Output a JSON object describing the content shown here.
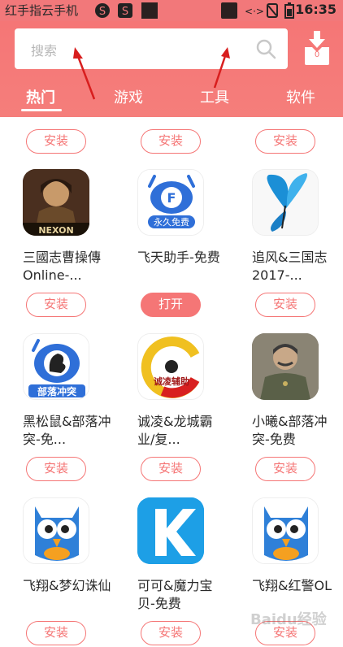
{
  "status": {
    "carrier_title": "红手指云手机",
    "time": "16:35"
  },
  "search": {
    "placeholder": "搜索",
    "download_badge": "0"
  },
  "tabs": [
    {
      "label": "热门"
    },
    {
      "label": "游戏"
    },
    {
      "label": "工具"
    },
    {
      "label": "软件"
    }
  ],
  "top_buttons": [
    "安装",
    "安装",
    "安装"
  ],
  "apps": [
    {
      "name": "三國志曹操傳Online-...",
      "button": "安装"
    },
    {
      "name": "飞天助手-免费",
      "button": "打开"
    },
    {
      "name": "追风&三国志2017-...",
      "button": "安装"
    },
    {
      "name": "黑松鼠&部落冲突-免...",
      "button": "安装"
    },
    {
      "name": "诚凌&龙城霸业/复...",
      "button": "安装"
    },
    {
      "name": "小曦&部落冲突-免费",
      "button": "安装"
    },
    {
      "name": "飞翔&梦幻诛仙",
      "button": "安装"
    },
    {
      "name": "可可&魔力宝贝-免费",
      "button": "安装"
    },
    {
      "name": "飞翔&红警OL",
      "button": "安装"
    }
  ],
  "icon_text": {
    "nexon": "NEXON",
    "forever_free": "永久免费",
    "tribe_conflict": "部落冲突",
    "cheng_ling": "诚凌辅助"
  },
  "watermark": "Baidu经验",
  "colors": {
    "accent": "#f57676"
  }
}
